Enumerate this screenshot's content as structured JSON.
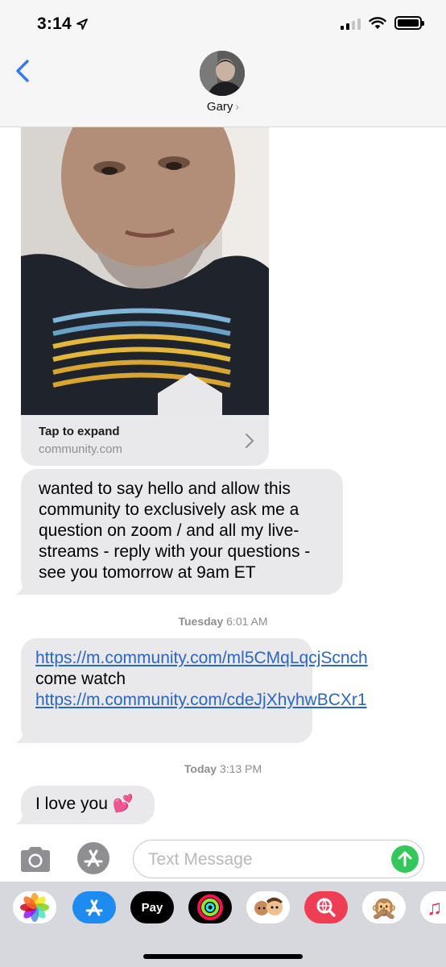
{
  "status_bar": {
    "time": "3:14",
    "icons": [
      "location-arrow-icon",
      "cellular-signal-icon",
      "wifi-icon",
      "battery-icon"
    ]
  },
  "header": {
    "back_icon": "chevron-left-icon",
    "contact_name": "Gary",
    "contact_chevron": "›"
  },
  "messages": {
    "media_card": {
      "title": "Tap to expand",
      "domain": "community.com",
      "icon": "chevron-right-icon"
    },
    "message_1": {
      "text": "wanted to say hello and allow this community to exclusively ask me a question on zoom / and all my live-streams - reply with your questions - see you tomorrow at 9am ET"
    },
    "timestamp_1": {
      "day": "Tuesday",
      "time": "6:01 AM"
    },
    "message_2": {
      "link_1": "https://m.community.com/ml5CMqLqcjScnch",
      "middle_text": " come watch ",
      "link_2": "https://m.community.com/cdeJjXhyhwBCXr1"
    },
    "timestamp_2": {
      "day": "Today",
      "time": "3:13 PM"
    },
    "message_3": {
      "text": "I love you",
      "emoji": "💕"
    }
  },
  "composer": {
    "camera_icon": "camera-icon",
    "apps_icon": "app-store-icon",
    "placeholder": "Text Message",
    "send_icon": "arrow-up-icon",
    "send_color": "#34c759"
  },
  "app_drawer": {
    "apps": [
      {
        "name": "photos-icon"
      },
      {
        "name": "app-store-icon"
      },
      {
        "name": "apple-pay-icon",
        "label": "Pay"
      },
      {
        "name": "activity-icon"
      },
      {
        "name": "memoji-icon"
      },
      {
        "name": "search-images-icon"
      },
      {
        "name": "animoji-monkey-icon",
        "emoji": "🙊"
      },
      {
        "name": "music-icon",
        "emoji": "♫"
      }
    ]
  },
  "colors": {
    "bubble": "#e9e9eb",
    "link": "#2b66c4",
    "accent_blue": "#3478f6"
  }
}
